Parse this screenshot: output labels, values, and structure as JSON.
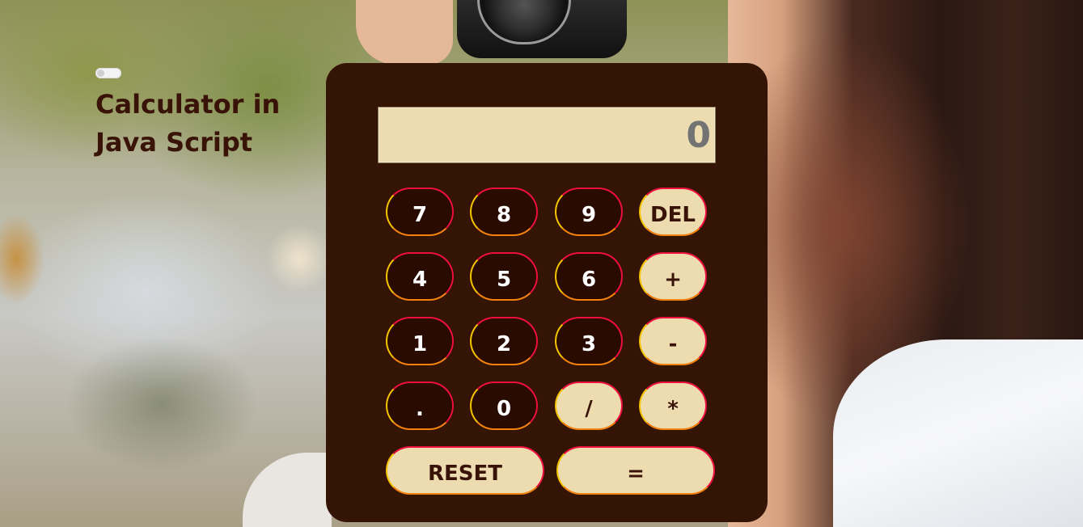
{
  "page": {
    "title": "Calculator in Java Script",
    "theme_toggle": "off"
  },
  "calculator": {
    "display_value": "0",
    "keys": {
      "k7": "7",
      "k8": "8",
      "k9": "9",
      "del": "DEL",
      "k4": "4",
      "k5": "5",
      "k6": "6",
      "add": "+",
      "k1": "1",
      "k2": "2",
      "k3": "3",
      "sub": "-",
      "dot": ".",
      "k0": "0",
      "div": "/",
      "mul": "*",
      "reset": "RESET",
      "equals": "="
    }
  },
  "colors": {
    "panel": "#341404",
    "display": "#ecdcb0",
    "dark_key": "#2a0b01",
    "light_key": "#ecdcb0",
    "title": "#3a1308",
    "key_border_red": "#ee0f3f",
    "key_border_yellow": "#f5c400",
    "key_border_orange": "#f3820f"
  }
}
